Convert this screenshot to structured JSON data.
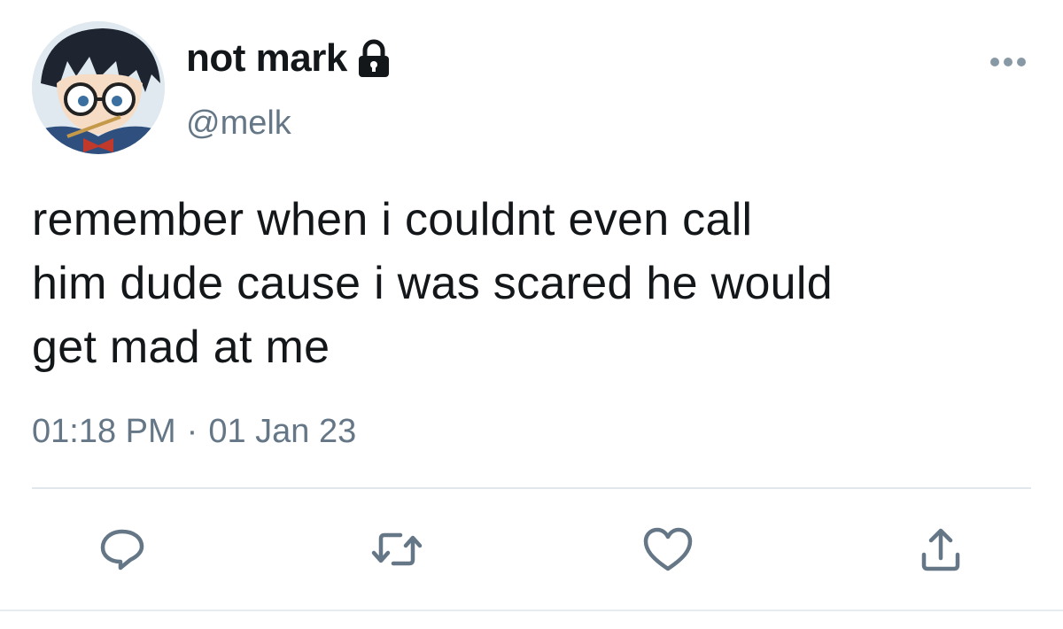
{
  "user": {
    "display_name": "not mark",
    "handle": "@melk",
    "protected_icon": "lock-icon",
    "avatar": "avatar-image"
  },
  "tweet": {
    "text_lines": [
      "remember when i couldnt even call",
      "him dude cause i was scared he would",
      "get mad at me"
    ],
    "time": "01:18 PM",
    "separator": "·",
    "date": "01 Jan 23"
  },
  "actions": {
    "reply_icon": "reply-icon",
    "retweet_icon": "retweet-icon",
    "like_icon": "heart-icon",
    "share_icon": "share-icon",
    "more_icon": "more-icon"
  },
  "colors": {
    "text": "#14171a",
    "secondary": "#657786",
    "divider": "#e1e8ed"
  }
}
